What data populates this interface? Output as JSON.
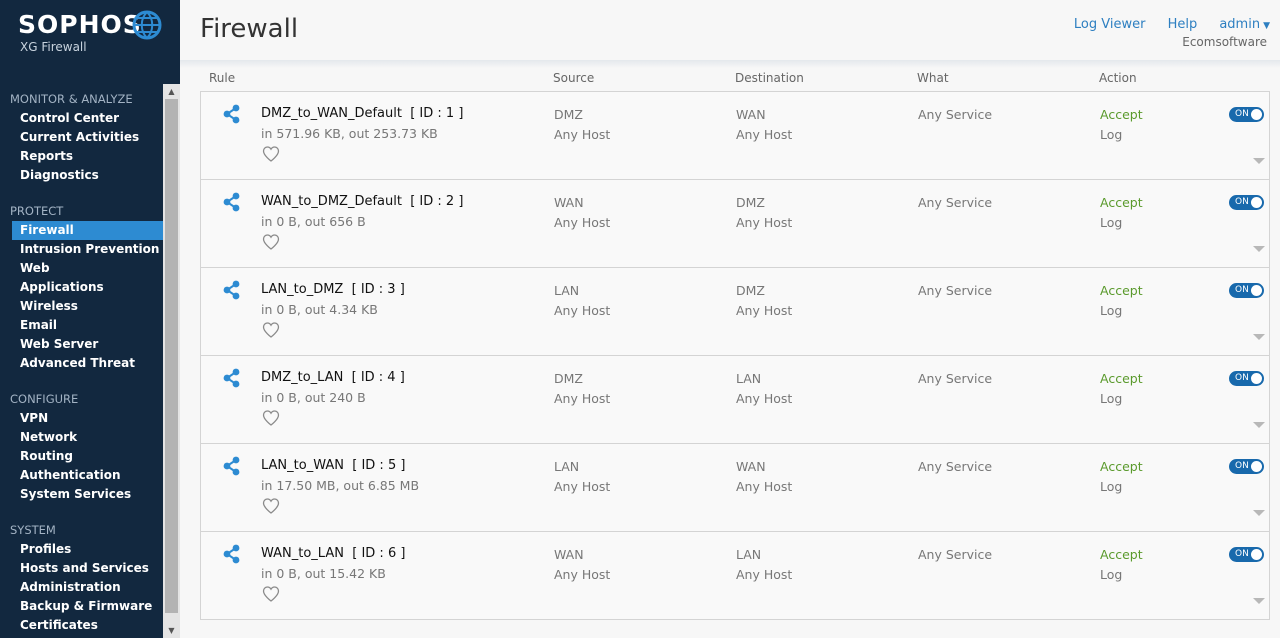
{
  "brand": {
    "logo": "SOPHOS",
    "product": "XG Firewall"
  },
  "sidebar": {
    "sections": [
      {
        "title": "MONITOR & ANALYZE",
        "items": [
          "Control Center",
          "Current Activities",
          "Reports",
          "Diagnostics"
        ]
      },
      {
        "title": "PROTECT",
        "items": [
          "Firewall",
          "Intrusion Prevention",
          "Web",
          "Applications",
          "Wireless",
          "Email",
          "Web Server",
          "Advanced Threat"
        ]
      },
      {
        "title": "CONFIGURE",
        "items": [
          "VPN",
          "Network",
          "Routing",
          "Authentication",
          "System Services"
        ]
      },
      {
        "title": "SYSTEM",
        "items": [
          "Profiles",
          "Hosts and Services",
          "Administration",
          "Backup & Firmware",
          "Certificates"
        ]
      }
    ],
    "active_item": "Firewall"
  },
  "header": {
    "title": "Firewall",
    "links": [
      "Log Viewer",
      "Help",
      "admin"
    ],
    "org": "Ecomsoftware"
  },
  "columns": {
    "rule": "Rule",
    "source": "Source",
    "destination": "Destination",
    "what": "What",
    "action": "Action"
  },
  "colors": {
    "sidebar_bg": "#12283f",
    "active_item": "#2d8bd2",
    "accept": "#5a9a2c",
    "toggle_on": "#1869ac",
    "link": "#2d7fc1"
  },
  "rules": [
    {
      "name": "DMZ_to_WAN_Default",
      "id_label": "[ ID : 1 ]",
      "traffic": "in 571.96 KB, out 253.73 KB",
      "src_zone": "DMZ",
      "src_host": "Any Host",
      "dst_zone": "WAN",
      "dst_host": "Any Host",
      "what": "Any Service",
      "action": "Accept",
      "log": "Log",
      "toggle": "ON"
    },
    {
      "name": "WAN_to_DMZ_Default",
      "id_label": "[ ID : 2 ]",
      "traffic": "in 0 B, out 656 B",
      "src_zone": "WAN",
      "src_host": "Any Host",
      "dst_zone": "DMZ",
      "dst_host": "Any Host",
      "what": "Any Service",
      "action": "Accept",
      "log": "Log",
      "toggle": "ON"
    },
    {
      "name": "LAN_to_DMZ",
      "id_label": "[ ID : 3 ]",
      "traffic": "in 0 B, out 4.34 KB",
      "src_zone": "LAN",
      "src_host": "Any Host",
      "dst_zone": "DMZ",
      "dst_host": "Any Host",
      "what": "Any Service",
      "action": "Accept",
      "log": "Log",
      "toggle": "ON"
    },
    {
      "name": "DMZ_to_LAN",
      "id_label": "[ ID : 4 ]",
      "traffic": "in 0 B, out 240 B",
      "src_zone": "DMZ",
      "src_host": "Any Host",
      "dst_zone": "LAN",
      "dst_host": "Any Host",
      "what": "Any Service",
      "action": "Accept",
      "log": "Log",
      "toggle": "ON"
    },
    {
      "name": "LAN_to_WAN",
      "id_label": "[ ID : 5 ]",
      "traffic": "in 17.50 MB, out 6.85 MB",
      "src_zone": "LAN",
      "src_host": "Any Host",
      "dst_zone": "WAN",
      "dst_host": "Any Host",
      "what": "Any Service",
      "action": "Accept",
      "log": "Log",
      "toggle": "ON"
    },
    {
      "name": "WAN_to_LAN",
      "id_label": "[ ID : 6 ]",
      "traffic": "in 0 B, out 15.42 KB",
      "src_zone": "WAN",
      "src_host": "Any Host",
      "dst_zone": "LAN",
      "dst_host": "Any Host",
      "what": "Any Service",
      "action": "Accept",
      "log": "Log",
      "toggle": "ON"
    }
  ]
}
